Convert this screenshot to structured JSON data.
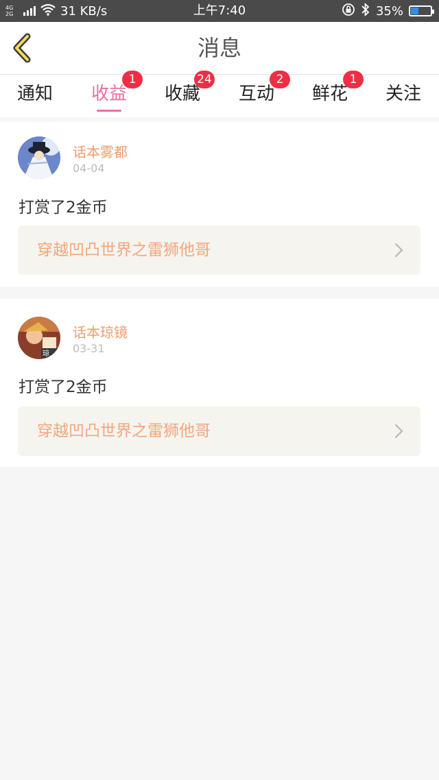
{
  "status_bar": {
    "network": "4G 2G",
    "speed": "31 KB/s",
    "time": "上午7:40",
    "battery": "35%"
  },
  "header": {
    "title": "消息"
  },
  "tabs": [
    {
      "label": "通知",
      "badge": ""
    },
    {
      "label": "收益",
      "badge": "1"
    },
    {
      "label": "收藏",
      "badge": "24"
    },
    {
      "label": "互动",
      "badge": "2"
    },
    {
      "label": "鲜花",
      "badge": "1"
    },
    {
      "label": "关注",
      "badge": ""
    }
  ],
  "messages": [
    {
      "user": "话本雾都",
      "date": "04-04",
      "text": "打赏了2金币",
      "book": "穿越凹凸世界之雷狮他哥"
    },
    {
      "user": "话本琼镜",
      "date": "03-31",
      "text": "打赏了2金币",
      "book": "穿越凹凸世界之雷狮他哥"
    }
  ],
  "colors": {
    "accent": "#e8709e",
    "badge": "#ef2e46",
    "username": "#f29b6b"
  }
}
